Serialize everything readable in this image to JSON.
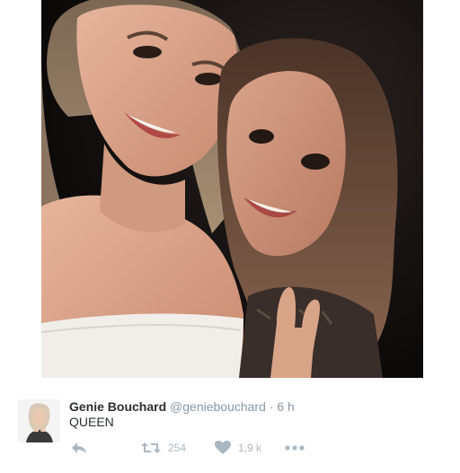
{
  "tweet": {
    "author_name": "Genie Bouchard",
    "author_handle": "@geniebouchard",
    "separator": "·",
    "time": "6 h",
    "text": "QUEEN"
  },
  "actions": {
    "reply_icon": "reply-icon",
    "retweet_icon": "retweet-icon",
    "retweet_count": "254",
    "like_icon": "heart-icon",
    "like_count": "1,9 k",
    "more_icon": "more-dots-icon"
  },
  "colors": {
    "name": "#292f33",
    "meta": "#8899a6",
    "action": "#aab8c2"
  }
}
